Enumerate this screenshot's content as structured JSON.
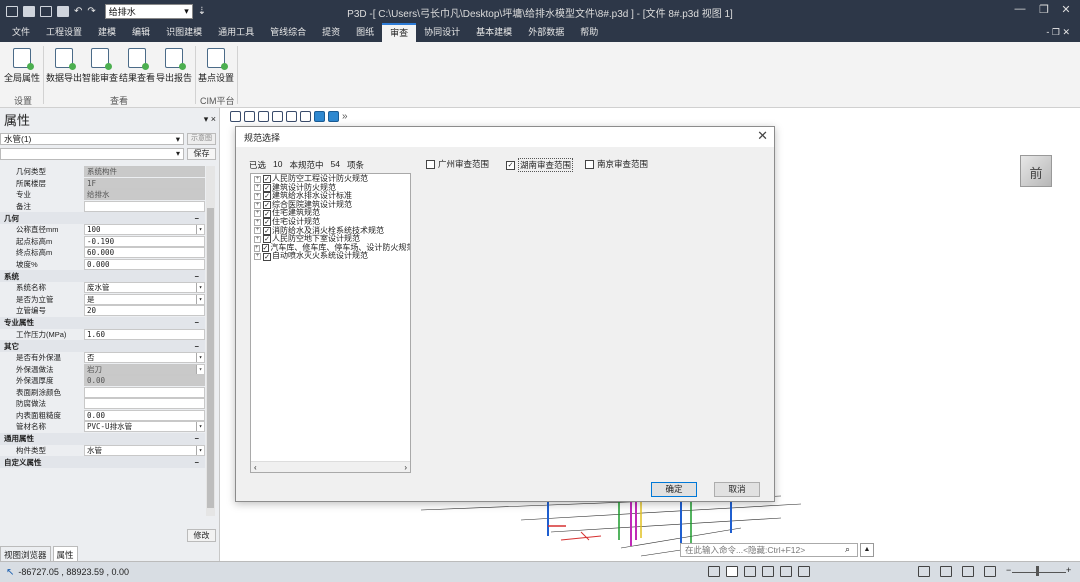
{
  "titlebar": {
    "combo_value": "给排水",
    "title": "P3D -[ C:\\Users\\弓长巾凡\\Desktop\\坪墉\\给排水模型文件\\8#.p3d ] - [文件 8#.p3d 视图 1]",
    "min": "—",
    "restore": "❐",
    "close": "✕"
  },
  "menu": [
    "文件",
    "工程设置",
    "建模",
    "编辑",
    "识图建模",
    "通用工具",
    "管线综合",
    "提资",
    "图纸",
    "审查",
    "协同设计",
    "基本建模",
    "外部数据",
    "帮助"
  ],
  "menu_active": "审查",
  "menu_right": "- ❐ ✕",
  "ribbon": {
    "buttons": [
      "全局属性",
      "数据导出",
      "智能审查",
      "结果查看",
      "导出报告",
      "基点设置"
    ],
    "groups": [
      "设置",
      "查看",
      "CIM平台"
    ]
  },
  "panel": {
    "title": "属性",
    "pin": "▾ ×",
    "type_value": "水管(1)",
    "display_btn": "示意图",
    "save_btn": "保存",
    "modify_btn": "修改",
    "rows_top": [
      {
        "k": "几何类型",
        "v": "系统构件",
        "ro": true
      },
      {
        "k": "所属楼层",
        "v": "1F",
        "ro": true
      },
      {
        "k": "专业",
        "v": "给排水",
        "ro": true
      },
      {
        "k": "备注",
        "v": "",
        "ro": false
      }
    ],
    "sec_geo": "几何",
    "rows_geo": [
      {
        "k": "公称直径mm",
        "v": "100",
        "dd": true
      },
      {
        "k": "起点标高m",
        "v": "-0.190"
      },
      {
        "k": "终点标高m",
        "v": "60.000"
      },
      {
        "k": "坡度%",
        "v": "0.000"
      }
    ],
    "sec_sys": "系统",
    "rows_sys": [
      {
        "k": "系统名称",
        "v": "废水管",
        "dd": true
      },
      {
        "k": "是否为立管",
        "v": "是",
        "dd": true
      },
      {
        "k": "立管编号",
        "v": "20"
      }
    ],
    "sec_pro": "专业属性",
    "rows_pro": [
      {
        "k": "工作压力(MPa)",
        "v": "1.60"
      }
    ],
    "sec_other": "其它",
    "rows_other": [
      {
        "k": "是否有外保温",
        "v": "否",
        "dd": true
      },
      {
        "k": "外保温做法",
        "v": "岩刀",
        "dd": true,
        "ro": true
      },
      {
        "k": "外保温厚度",
        "v": "0.00",
        "ro": true
      },
      {
        "k": "表面刷涂颜色",
        "v": ""
      },
      {
        "k": "防腐做法",
        "v": ""
      },
      {
        "k": "内表面粗糙度",
        "v": "0.00"
      },
      {
        "k": "管材名称",
        "v": "PVC-U排水管",
        "dd": true
      }
    ],
    "sec_gen": "通用属性",
    "rows_gen": [
      {
        "k": "构件类型",
        "v": "水管",
        "dd": true
      }
    ],
    "sec_custom": "自定义属性",
    "tabs": [
      "视图浏览器",
      "属性"
    ]
  },
  "dialog": {
    "title": "规范选择",
    "close": "✕",
    "count_prefix": "已选",
    "count_selected": "10",
    "count_mid": "本规范中",
    "count_total": "54",
    "count_suffix": "项条",
    "tree": [
      "人民防空工程设计防火规范",
      "建筑设计防火规范",
      "建筑给水排水设计标准",
      "综合医院建筑设计规范",
      "住宅建筑规范",
      "住宅设计规范",
      "消防给水及消火栓系统技术规范",
      "人民防空地下室设计规范",
      "汽车库、修车库、停车场、设计防火规范",
      "自动喷水灭火系统设计规范"
    ],
    "scopes": [
      {
        "label": "广州审查范围",
        "checked": false
      },
      {
        "label": "湖南审查范围",
        "checked": true
      },
      {
        "label": "南京审查范围",
        "checked": false
      }
    ],
    "ok": "确定",
    "cancel": "取消"
  },
  "cube_label": "前",
  "command_placeholder": "在此输入命令...<隐藏:Ctrl+F12>",
  "status_coords": "-86727.05 , 88923.59 , 0.00"
}
